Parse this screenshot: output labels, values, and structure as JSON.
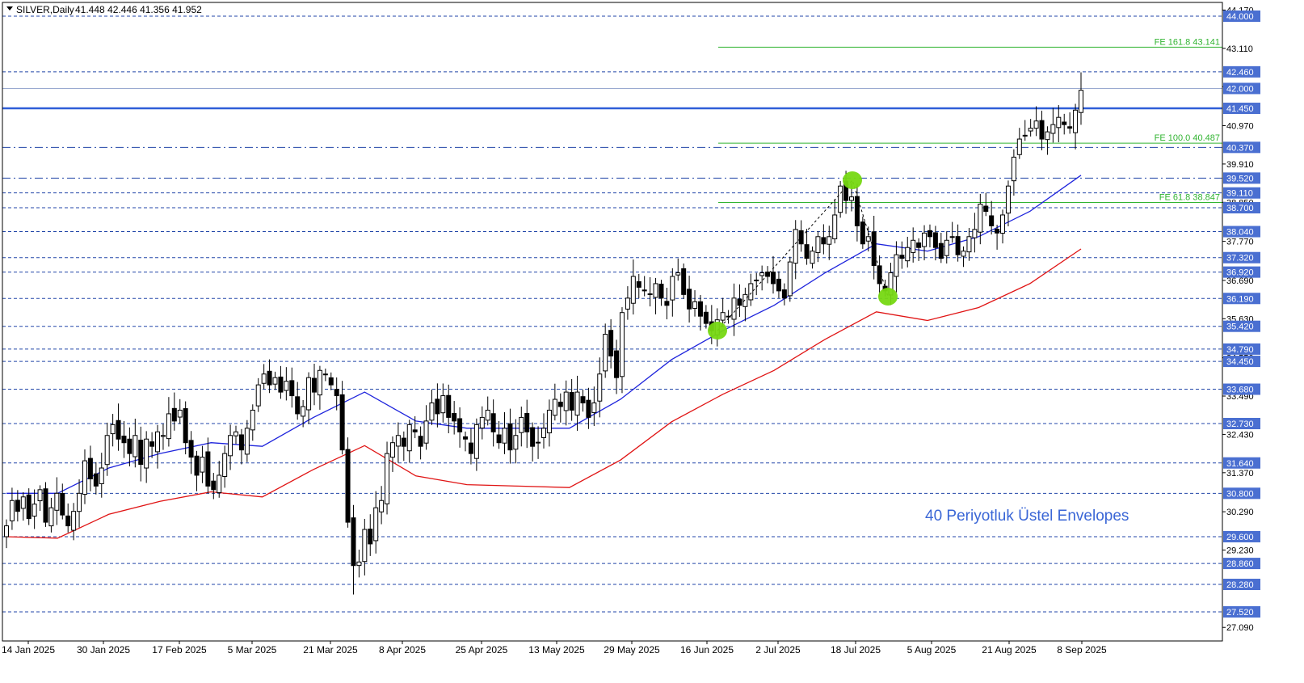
{
  "header": {
    "symbol": "SILVER,Daily",
    "ohlc": "41.448 42.446 41.356 41.952"
  },
  "chart_data": {
    "type": "candlestick",
    "title": "SILVER,Daily",
    "ylim": [
      26.5,
      44.4
    ],
    "y_tick_labels": [
      "44.170",
      "43.110",
      "42.050",
      "40.970",
      "39.910",
      "38.850",
      "37.770",
      "36.690",
      "35.630",
      "34.550",
      "33.490",
      "32.430",
      "31.370",
      "30.290",
      "29.230",
      "27.090"
    ],
    "x_tick_labels": [
      "14 Jan 2025",
      "30 Jan 2025",
      "17 Feb 2025",
      "5 Mar 2025",
      "21 Mar 2025",
      "8 Apr 2025",
      "25 Apr 2025",
      "13 May 2025",
      "29 May 2025",
      "16 Jun 2025",
      "2 Jul 2025",
      "18 Jul 2025",
      "5 Aug 2025",
      "21 Aug 2025",
      "8 Sep 2025"
    ],
    "levels": [
      "44.000",
      "42.460",
      "42.000",
      "41.450",
      "40.370",
      "39.520",
      "39.110",
      "38.700",
      "38.040",
      "37.320",
      "36.920",
      "36.190",
      "35.420",
      "34.790",
      "34.450",
      "33.680",
      "32.730",
      "31.640",
      "30.800",
      "29.600",
      "28.860",
      "28.280",
      "27.520"
    ],
    "key_level": "41.450",
    "fibonacci": [
      {
        "label": "FE 161.8 43.141",
        "value": 43.141
      },
      {
        "label": "FE 100.0 40.487",
        "value": 40.487
      },
      {
        "label": "FE 61.8 38.847",
        "value": 38.847
      }
    ],
    "closes": [
      29.9,
      30.6,
      30.3,
      30.7,
      30.1,
      30.5,
      30.9,
      30.0,
      30.4,
      30.8,
      30.2,
      29.9,
      30.3,
      30.8,
      31.7,
      31.2,
      31.0,
      31.5,
      32.4,
      32.7,
      32.3,
      32.2,
      31.9,
      32.4,
      31.6,
      32.3,
      32.1,
      32.5,
      32.4,
      33.0,
      32.8,
      33.1,
      32.2,
      31.8,
      31.3,
      31.8,
      31.0,
      30.9,
      31.3,
      31.9,
      32.4,
      32.5,
      32.0,
      32.6,
      33.1,
      33.8,
      34.1,
      33.8,
      34.0,
      33.6,
      33.9,
      33.5,
      33.0,
      33.2,
      34.0,
      33.6,
      34.2,
      34.1,
      33.8,
      33.5,
      32.0,
      30.0,
      28.8,
      28.9,
      29.8,
      29.4,
      30.4,
      30.6,
      31.9,
      32.2,
      32.4,
      32.1,
      32.7,
      32.5,
      32.1,
      32.8,
      33.3,
      33.0,
      33.5,
      32.9,
      32.8,
      32.5,
      32.3,
      31.9,
      32.7,
      32.9,
      33.1,
      32.5,
      32.2,
      32.6,
      32.0,
      32.4,
      32.9,
      32.5,
      32.1,
      32.2,
      32.6,
      33.1,
      33.4,
      33.2,
      33.6,
      33.1,
      33.6,
      33.3,
      32.9,
      33.3,
      34.1,
      35.2,
      34.6,
      34.0,
      35.8,
      36.2,
      36.8,
      36.5,
      36.4,
      36.3,
      36.6,
      36.2,
      36.0,
      36.8,
      36.9,
      36.3,
      35.9,
      36.1,
      35.7,
      35.5,
      35.3,
      35.6,
      35.8,
      35.7,
      36.2,
      36.0,
      36.3,
      36.6,
      36.7,
      36.9,
      36.8,
      36.6,
      36.4,
      36.2,
      37.2,
      38.1,
      37.7,
      37.3,
      37.5,
      37.9,
      37.7,
      37.9,
      38.5,
      39.3,
      38.9,
      39.0,
      38.2,
      37.7,
      37.9,
      37.1,
      36.6,
      36.4,
      36.9,
      37.4,
      37.3,
      37.6,
      37.8,
      37.6,
      38.0,
      37.9,
      37.6,
      37.3,
      37.8,
      37.9,
      37.4,
      37.5,
      37.9,
      38.1,
      38.8,
      38.6,
      38.2,
      38.0,
      38.5,
      39.3,
      40.1,
      40.6,
      40.7,
      40.9,
      41.1,
      40.6,
      40.8,
      41.0,
      41.2,
      41.0,
      40.9,
      41.4,
      41.95
    ],
    "ema_mid_sample": [
      30.8,
      30.8,
      31.5,
      31.9,
      32.2,
      32.1,
      32.9,
      33.6,
      32.8,
      32.6,
      32.6,
      32.6,
      33.4,
      34.5,
      35.3,
      36.0,
      36.9,
      37.7,
      37.5,
      37.9,
      38.6,
      39.6
    ],
    "envelope_upper_color": "#1e24dc",
    "envelope_lower_color": "#e01414",
    "annotation": "40 Periyotluk Üstel Envelopes",
    "pattern_markers": [
      "low-1",
      "high-1",
      "low-2"
    ]
  },
  "colors": {
    "background": "#ffffff",
    "candle": "#000000",
    "level_line": "#2246a8",
    "key_level": "#2f5ed8",
    "fib_line": "#32b432",
    "highlight": "#4a6fd1",
    "marker": "#76d812"
  }
}
